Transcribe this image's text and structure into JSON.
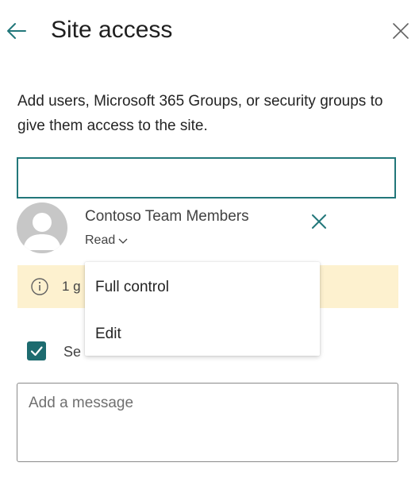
{
  "header": {
    "title": "Site access"
  },
  "description": "Add users, Microsoft 365 Groups, or security groups to give them access to the site.",
  "search": {
    "value": "",
    "placeholder": ""
  },
  "member": {
    "name": "Contoso Team Members",
    "permission": "Read"
  },
  "warning": {
    "text_visible": "1 g"
  },
  "permission_menu": {
    "items": [
      {
        "label": "Full control"
      },
      {
        "label": "Edit"
      }
    ]
  },
  "send_email": {
    "label_visible": "Se",
    "checked": true
  },
  "message": {
    "value": "",
    "placeholder": "Add a message"
  },
  "colors": {
    "accent": "#22777a",
    "checkbox": "#1d6b6f",
    "warning_bg": "#fdf1cf",
    "avatar": "#c7c7c7"
  },
  "icons": {
    "back": "arrow-left-icon",
    "close": "close-icon",
    "remove": "close-icon",
    "chevron": "chevron-down-icon",
    "warning": "info-icon",
    "avatar": "person-icon",
    "checkbox": "checkmark-icon"
  }
}
